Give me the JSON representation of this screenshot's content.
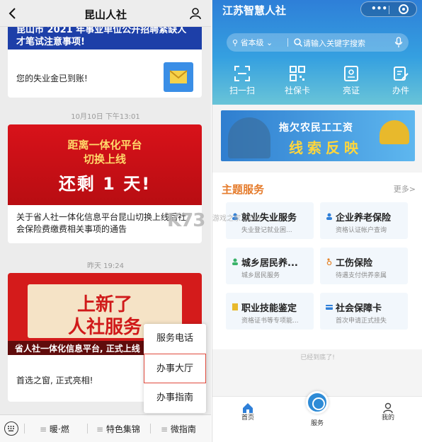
{
  "left": {
    "title": "昆山人社",
    "card1": {
      "banner": "昆山市 2021 年事业单位公开招聘紧缺人才笔试注意事项!",
      "message": "您的失业金已到账!"
    },
    "ts1": "10月10日 下午13:01",
    "card2": {
      "line1": "距离一体化平台",
      "line2": "切换上线",
      "line3": "还剩 1 天!",
      "caption": "关于省人社一体化信息平台昆山切换上线后社会保险费缴费相关事项的通告"
    },
    "ts2": "昨天 19:24",
    "card3": {
      "headline1": "上新了",
      "headline2": "人社服务",
      "strip": "省人社一体化信息平台, 正式上线",
      "caption": "首选之窗, 正式亮相!"
    },
    "popup": [
      "服务电话",
      "办事大厅",
      "办事指南"
    ],
    "bottom_menu": [
      "暖·燃",
      "特色集锦",
      "微指南"
    ]
  },
  "right": {
    "title": "江苏智慧人社",
    "capsule_dots": "•••",
    "search": {
      "location": "省本级",
      "placeholder": "请输入关键字搜索"
    },
    "quick": [
      {
        "label": "扫一扫",
        "icon": "scan-icon"
      },
      {
        "label": "社保卡",
        "icon": "qrcode-icon"
      },
      {
        "label": "亮证",
        "icon": "id-card-icon"
      },
      {
        "label": "办件",
        "icon": "edit-doc-icon"
      }
    ],
    "promo": {
      "title": "拖欠农民工工资",
      "subtitle": "线索反映"
    },
    "section": {
      "title": "主题服务",
      "more": "更多>",
      "services": [
        {
          "name": "就业失业服务",
          "desc": "失业登记就业困...",
          "color": "#2f7fd8"
        },
        {
          "name": "企业养老保险",
          "desc": "资格认证帐户查询",
          "color": "#2f7fd8"
        },
        {
          "name": "城乡居民养...",
          "desc": "城乡居民服务",
          "color": "#3bb36a"
        },
        {
          "name": "工伤保险",
          "desc": "待遇支付供养亲属",
          "color": "#e5852c"
        },
        {
          "name": "职业技能鉴定",
          "desc": "资格证书等专项能...",
          "color": "#e8b92c"
        },
        {
          "name": "社会保障卡",
          "desc": "首次申请正式挂失",
          "color": "#2f7fd8"
        }
      ]
    },
    "end_text": "已经到底了!",
    "tabs": [
      {
        "label": "首页",
        "icon": "home-icon"
      },
      {
        "label": "服务",
        "icon": "service-icon"
      },
      {
        "label": "我的",
        "icon": "profile-icon"
      }
    ]
  },
  "watermark": "K73",
  "watermark_sub": "游戏之家 .com"
}
